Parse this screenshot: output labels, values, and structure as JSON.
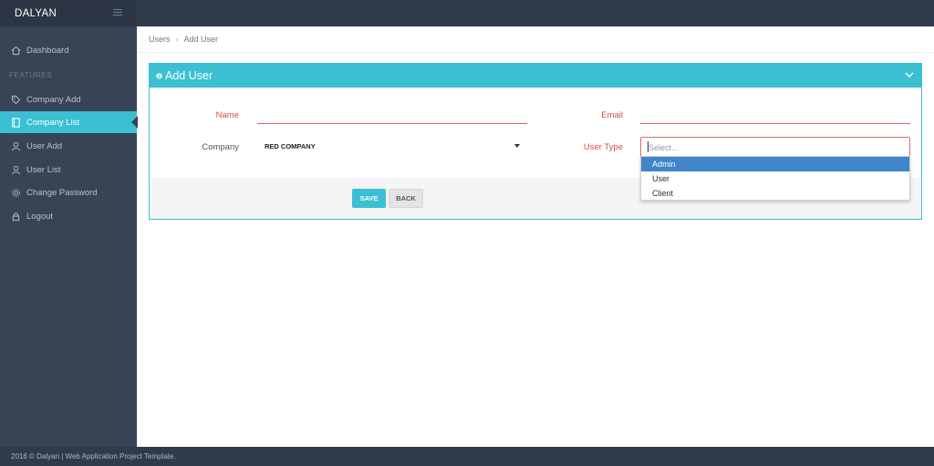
{
  "brand": "DALYAN",
  "sidebar": {
    "items": [
      {
        "label": "Dashboard",
        "icon": "home-icon"
      },
      {
        "label": "Company Add",
        "icon": "tag-icon"
      },
      {
        "label": "Company List",
        "icon": "book-icon",
        "active": true
      },
      {
        "label": "User Add",
        "icon": "user-icon"
      },
      {
        "label": "User List",
        "icon": "user-icon"
      },
      {
        "label": "Change Password",
        "icon": "gear-icon"
      },
      {
        "label": "Logout",
        "icon": "lock-icon"
      }
    ],
    "section_header": "FEATURES"
  },
  "breadcrumb": {
    "items": [
      "Users",
      "Add User"
    ],
    "separator": "›"
  },
  "panel": {
    "title": "Add User",
    "icon": "user-icon"
  },
  "form": {
    "name_label": "Name",
    "email_label": "Email",
    "company_label": "Company",
    "company_value": "RED COMPANY",
    "usertype_label": "User Type",
    "usertype_placeholder": "Select...",
    "usertype_options": [
      "Admin",
      "User",
      "Client"
    ],
    "highlighted_option": "Admin"
  },
  "buttons": {
    "save": "SAVE",
    "back": "BACK"
  },
  "footer": "2016 © Dalyan | Web Application Project Template.",
  "colors": {
    "accent": "#3bc0d3",
    "sidebar": "#364455",
    "topbar": "#2f3b4b",
    "required": "#e04848",
    "highlight": "#3f86c8"
  }
}
